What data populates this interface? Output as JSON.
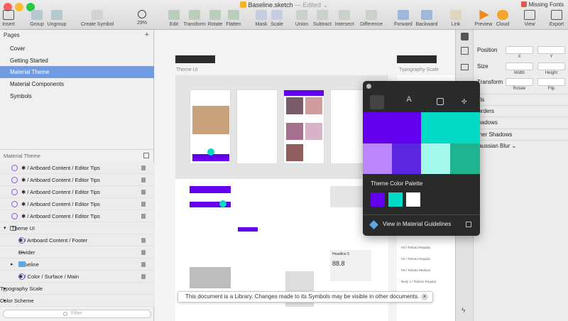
{
  "window": {
    "title": "Baseline.sketch",
    "edited": "— Edited ⌄",
    "missing_fonts": "Missing Fonts"
  },
  "toolbar": {
    "insert": "Insert",
    "group": "Group",
    "ungroup": "Ungroup",
    "create_symbol": "Create Symbol",
    "zoom": "29%",
    "edit": "Edit",
    "transform": "Transform",
    "rotate": "Rotate",
    "flatten": "Flatten",
    "mask": "Mask",
    "scale": "Scale",
    "union": "Union",
    "subtract": "Subtract",
    "intersect": "Intersect",
    "difference": "Difference",
    "forward": "Forward",
    "backward": "Backward",
    "link": "Link",
    "preview": "Preview",
    "cloud": "Cloud",
    "view": "View",
    "export": "Export"
  },
  "pages": {
    "header": "Pages",
    "add": "+",
    "items": [
      {
        "label": "Cover"
      },
      {
        "label": "Getting Started"
      },
      {
        "label": "Material Theme"
      },
      {
        "label": "Material Components"
      },
      {
        "label": "Symbols"
      }
    ]
  },
  "layers": {
    "header": "Material Theme",
    "items": [
      {
        "label": "✱ / Artboard Content / Editor Tips"
      },
      {
        "label": "✱ / Artboard Content / Editor Tips"
      },
      {
        "label": "✱ / Artboard Content / Editor Tips"
      },
      {
        "label": "✱ / Artboard Content / Editor Tips"
      },
      {
        "label": "✱ / Artboard Content / Editor Tips"
      },
      {
        "label": "Theme UI"
      },
      {
        "label": "✱ / Artboard Content / Footer"
      },
      {
        "label": "Divider"
      },
      {
        "label": "Baseline"
      },
      {
        "label": "✱ / Color / Surface / Main"
      },
      {
        "label": "Typography Scale"
      },
      {
        "label": "Color Scheme"
      }
    ],
    "filter_placeholder": "Filter"
  },
  "canvas": {
    "theme_ui_label": "Theme UI",
    "typography_label": "Typography Scale",
    "headline": "Headline 5",
    "value_88": "88.8",
    "type_rows": [
      "H3 / Roboto Regular",
      "H4 / Roboto Regular",
      "H5 / Roboto Medium",
      "Body 1 / Roboto Regular"
    ]
  },
  "popover": {
    "palette_title": "Theme Color Palette",
    "link": "View in Material Guidelines",
    "colors": [
      "#6200ee",
      "#3700b3",
      "#03dac6",
      "#018786",
      "#bb86fc",
      "#2cdbc5",
      "#7a4df2",
      "#5b26e0",
      "#a2f9ec",
      "#1fb38f"
    ],
    "swatches": [
      "#6200ee",
      "#03dac6",
      "#ffffff"
    ]
  },
  "inspector": {
    "position": "Position",
    "x": "X",
    "y": "Y",
    "size": "Size",
    "width": "Width",
    "height": "Height",
    "transform": "Transform",
    "rotate": "Rotate",
    "flip": "Flip",
    "fills": "Fills",
    "borders": "Borders",
    "shadows": "Shadows",
    "inner_shadows": "Inner Shadows",
    "blur": "Gaussian Blur ⌄"
  },
  "banner": {
    "text": "This document is a Library. Changes made to its Symbols may be visible in other documents.",
    "close": "×"
  }
}
